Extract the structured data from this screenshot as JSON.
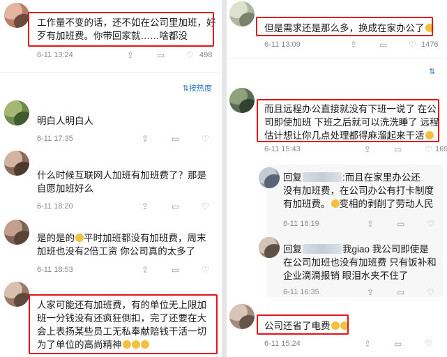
{
  "left": {
    "sort_label": "按热度",
    "comments": [
      {
        "text": "工作量不变的话，还不如在公司里加班，好\n歹有加班费。你带回家就……啥都没",
        "date": "6-11 13:24",
        "likes": "498"
      },
      {
        "text": "明白人明白人",
        "date": "6-11 17:35",
        "likes": ""
      },
      {
        "text": "什么时候互联网人加班有加班费了？那是\n自愿加班好么",
        "date": "6-11 18:20",
        "likes": ""
      },
      {
        "text_a": "是的是的",
        "text_b": "平时加班都没有加班费，周末\n加班也没有2倍工资 你公司真的太多了",
        "date": "6-11 18:53",
        "likes": ""
      },
      {
        "text": "人家可能还有加班费，有的单位无上限加\n班一分钱没有还疯狂倒扣，完了还要在大\n会上表扬某些员工无私奉献赔钱干活一切\n为了单位的高尚精神",
        "date": "",
        "likes": ""
      }
    ]
  },
  "right": {
    "comments": [
      {
        "text": "但是需求还是那么多，换成在家办公了",
        "date": "6-11 13:09",
        "likes": "1476"
      },
      {
        "text": "而且远程办公直接就没有下班一说了 在公\n司即使加班 下班之后就可以洗洗睡了 远程\n估计想让你几点处理都得麻溜起来干活",
        "date": "6-11 15:43",
        "likes": "169"
      }
    ],
    "replies": [
      {
        "prefix": "回复",
        "text_a": ":而且在家里办公还",
        "text_b": "没有加班费，在公司办公有打卡制度\n有加班费。",
        "text_c": "变相的剥削了劳动人民",
        "date": "6-11 16:19",
        "likes": ""
      },
      {
        "prefix": "回复",
        "text_a": "我giao 我公司即使是",
        "text_b": "在公司加班也没有加班费 只有饭补和\n企业滴滴报销 眼泪水夹不住了",
        "date": "6-11 16:35",
        "likes": ""
      }
    ],
    "last": {
      "text": "公司还省了电费",
      "date": "6-11 15:24",
      "likes": ""
    }
  },
  "colors": {
    "highlight": "#e4141b",
    "link": "#2e78c7",
    "meta": "#888888"
  },
  "icons": [
    "share-icon",
    "comment-icon",
    "like-icon",
    "sort-icon",
    "emoji-icon"
  ]
}
